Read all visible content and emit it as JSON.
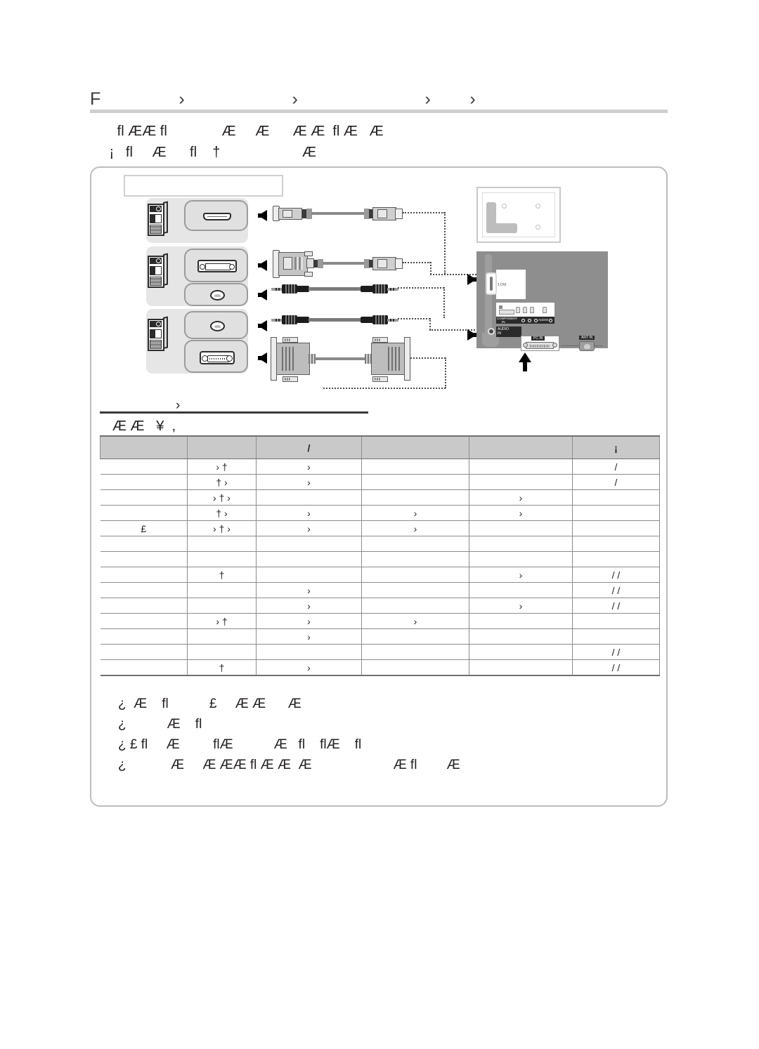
{
  "document": {
    "type": "tv-user-manual-page",
    "note": "Source PDF rendered with broken font encoding; most glyphs are missing and only stray characters are visible.",
    "page_bg": "#ffffff",
    "ink": "#231f20"
  },
  "header": {
    "title_glyphs": "F                ›                      ›                          ›        ›",
    "rule_color": "#cfcfcf"
  },
  "intro": {
    "lines": [
      "   fl ÆÆ fl              Æ     Æ      Æ Æ  fl Æ   Æ",
      " ¡   fl     Æ      fl    †                     Æ"
    ]
  },
  "diagram": {
    "caption_box_text": "",
    "pc_sources": [
      {
        "name": "pc-hdmi",
        "port": "hdmi"
      },
      {
        "name": "pc-dvi-audio",
        "port": "dvi+audio"
      },
      {
        "name": "pc-audio-dsub",
        "port": "audio+dsub"
      }
    ],
    "cables": [
      {
        "name": "hdmi-cable",
        "kind": "hdmi"
      },
      {
        "name": "dvi-hdmi-cable",
        "kind": "dvi"
      },
      {
        "name": "audio-cable-1",
        "kind": "audio-3.5mm"
      },
      {
        "name": "audio-cable-2",
        "kind": "audio-3.5mm"
      },
      {
        "name": "d-sub-cable",
        "kind": "d-sub-15pin"
      }
    ],
    "tv_panel": {
      "dvi_label": "1 DVI",
      "component_label": "COMPONENT\nIN",
      "audio_label": "AUDIO\nIN",
      "pc_in_label": "PC IN",
      "ant_in_label": "ANT IN",
      "audio_rca_label": "AUDIO"
    }
  },
  "mid_caption": {
    "glyph_above": "›",
    "text": "Æ Æ   ¥  ,"
  },
  "table": {
    "headers": [
      "",
      "",
      "/",
      "",
      "",
      "¡"
    ],
    "rows": [
      {
        "cells": [
          "",
          "› †",
          "›",
          "",
          "",
          "/"
        ],
        "group_start": true
      },
      {
        "cells": [
          "",
          "† ›",
          "›",
          "",
          "",
          "/"
        ]
      },
      {
        "cells": [
          "",
          "› † ›",
          "",
          "",
          "›",
          ""
        ],
        "group_start": true
      },
      {
        "cells": [
          "",
          "† ›",
          "›",
          "›",
          "›",
          ""
        ]
      },
      {
        "cells": [
          "£",
          "› † ›",
          "›",
          "›",
          "",
          ""
        ],
        "group_start": true,
        "rowspan_label": 3
      },
      {
        "cells": [
          "",
          "",
          "",
          "",
          "",
          ""
        ]
      },
      {
        "cells": [
          "",
          "",
          "",
          "",
          "",
          ""
        ]
      },
      {
        "cells": [
          "",
          "†",
          "",
          "",
          "›",
          "/ /"
        ],
        "rowspan_label": 3
      },
      {
        "cells": [
          "",
          "",
          "›",
          "",
          "",
          "/ /"
        ]
      },
      {
        "cells": [
          "",
          "",
          "›",
          "",
          "›",
          "/ /"
        ]
      },
      {
        "cells": [
          "",
          "› †",
          "›",
          "›",
          "",
          ""
        ],
        "rowspan_label": 3
      },
      {
        "cells": [
          "",
          "",
          "›",
          "",
          "",
          ""
        ]
      },
      {
        "cells": [
          "",
          "",
          "",
          "",
          "",
          "/ /"
        ]
      },
      {
        "cells": [
          "",
          "†",
          "›",
          "",
          "",
          "/ /"
        ],
        "last": true
      }
    ]
  },
  "notes": {
    "bullet": "¿",
    "lines": [
      "¿  Æ    fl           £     Æ Æ      Æ",
      "¿           Æ    fl",
      "¿ £ fl     Æ         flÆ           Æ   fl    flÆ    fl",
      "¿            Æ     Æ ÆÆ fl Æ Æ  Æ                      Æ fl        Æ"
    ]
  }
}
